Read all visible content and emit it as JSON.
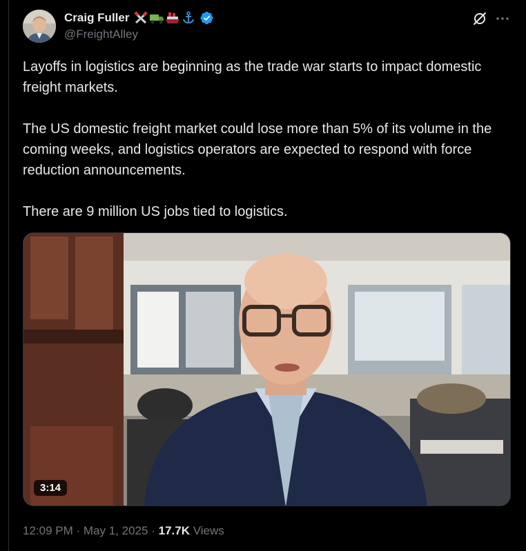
{
  "author": {
    "display_name": "Craig Fuller",
    "handle": "@FreightAlley",
    "name_emojis": [
      "crossed-tools-emoji",
      "truck-emoji",
      "ship-emoji",
      "anchor-emoji"
    ],
    "verified": true,
    "verified_color": "#1d9bf0"
  },
  "tweet": {
    "paragraphs": [
      "Layoffs in logistics are beginning as the trade war starts to impact domestic freight markets.",
      "The US domestic freight market could lose more than 5% of its volume in the coming weeks, and logistics operators are expected to respond with force reduction announcements.",
      "There are 9 million US jobs tied to logistics."
    ]
  },
  "media": {
    "type": "video",
    "duration": "3:14"
  },
  "meta": {
    "time": "12:09 PM",
    "separator": "·",
    "date": "May 1, 2025",
    "views_count": "17.7K",
    "views_label": "Views"
  },
  "colors": {
    "background": "#000000",
    "text_primary": "#e7e9ea",
    "text_secondary": "#71767b",
    "border": "#2f3336"
  },
  "icons": {
    "grok": "grok-icon",
    "more": "more-options-icon"
  }
}
